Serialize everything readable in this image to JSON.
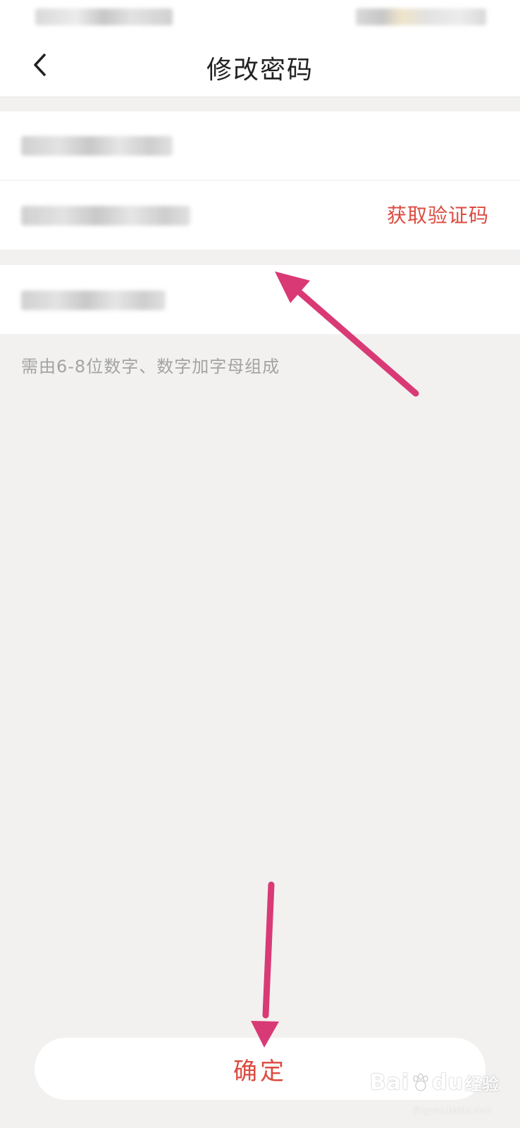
{
  "header": {
    "title": "修改密码",
    "back_icon": "chevron-left-icon"
  },
  "form": {
    "verification_button_label": "获取验证码",
    "password_hint": "需由6-8位数字、数字加字母组成"
  },
  "footer": {
    "confirm_label": "确定"
  },
  "watermark": {
    "brand": "Bai",
    "brand_suffix": "du",
    "brand_cn": "经验",
    "url": "jingyan.baidu.com"
  },
  "colors": {
    "accent": "#dc4a3f",
    "annotation_arrow": "#d93a75",
    "background": "#f2f1f0",
    "surface": "#ffffff"
  }
}
